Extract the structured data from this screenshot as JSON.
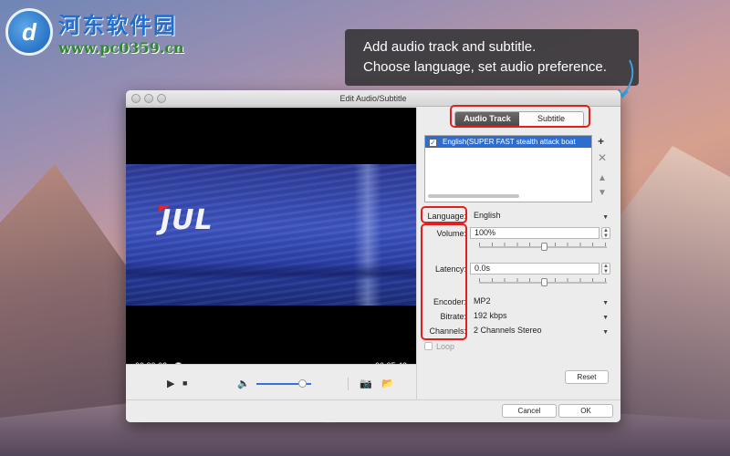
{
  "watermark": {
    "title": "河东软件园",
    "url": "www.pc0359.cn"
  },
  "tooltip": {
    "line1": "Add audio track and subtitle.",
    "line2": "Choose language, set audio preference."
  },
  "window": {
    "title": "Edit Audio/Subtitle"
  },
  "video": {
    "logo_text": "JUL",
    "current_time": "00:00:02",
    "total_time": "00:05:42",
    "progress": 0.0
  },
  "player": {
    "volume_level": 0.85
  },
  "tabs": [
    {
      "label": "Audio Track",
      "selected": true
    },
    {
      "label": "Subtitle",
      "selected": false
    }
  ],
  "track_list": [
    {
      "label": "English(SUPER FAST stealth attack boat",
      "checked": true
    }
  ],
  "settings": {
    "language_label": "Language:",
    "language": "English",
    "volume_label": "Volume:",
    "volume": "100%",
    "latency_label": "Latency:",
    "latency": "0.0s",
    "encoder_label": "Encoder:",
    "encoder": "MP2",
    "bitrate_label": "Bitrate:",
    "bitrate": "192 kbps",
    "channels_label": "Channels:",
    "channels": "2 Channels Stereo",
    "loop_label": "Loop",
    "reset_label": "Reset"
  },
  "footer": {
    "cancel_label": "Cancel",
    "ok_label": "OK"
  },
  "colors": {
    "selection": "#2e6dd0",
    "highlight": "#e02020",
    "progress": "#3a70d8"
  }
}
